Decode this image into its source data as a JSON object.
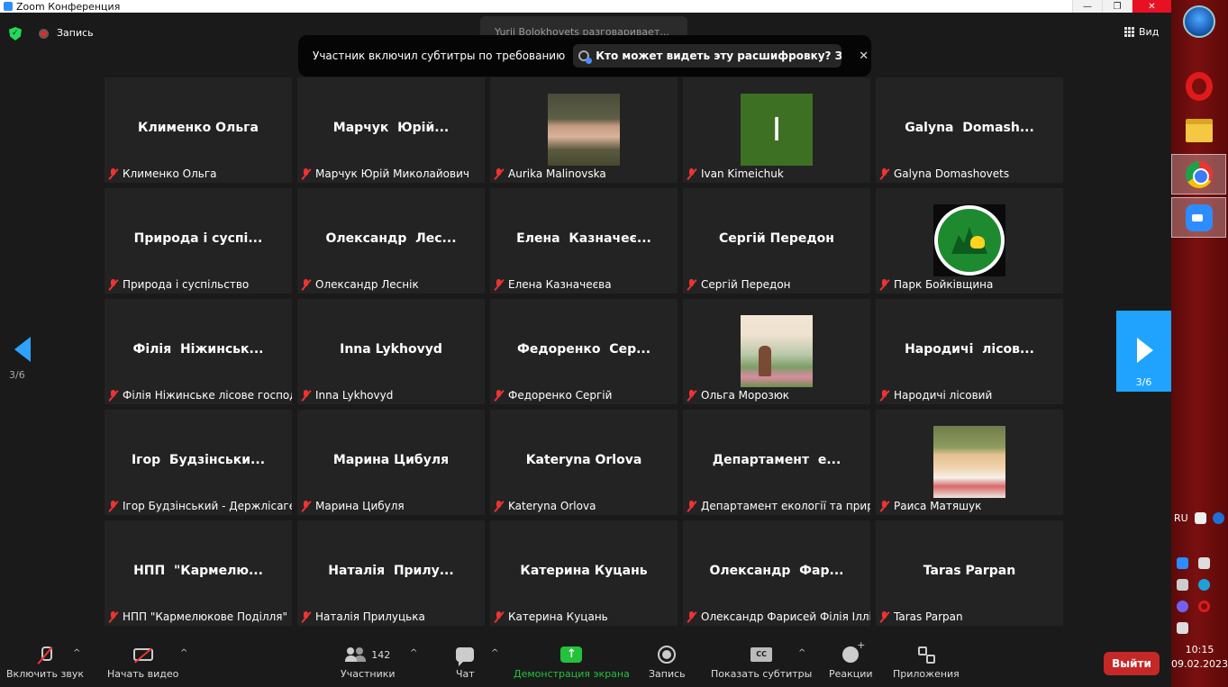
{
  "window": {
    "title": "Zoom Конференция",
    "minimize": "—",
    "maximize": "❐",
    "close": "✕"
  },
  "topbar": {
    "record_label": "Запись",
    "view_label": "Вид",
    "speaking_text": "Yurii Bolokhovets разговаривает...",
    "notification_text": "Участник включил субтитры по требованию",
    "notification_link": "Кто может видеть эту расшифровку? За...",
    "notification_close": "✕"
  },
  "grid": [
    {
      "big": "Клименко Ольга",
      "name": "Клименко Ольга",
      "photo": ""
    },
    {
      "big": "Марчук  Юрій...",
      "name": "Марчук Юрій Миколайович",
      "photo": ""
    },
    {
      "big": "",
      "name": "Aurika Malinovska",
      "photo": "aurika"
    },
    {
      "big": "",
      "name": "Ivan Kimeichuk",
      "photo": "ivan",
      "letter": "I"
    },
    {
      "big": "Galyna  Domash...",
      "name": "Galyna Domashovets",
      "photo": ""
    },
    {
      "big": "Природа і суспі...",
      "name": "Природа і суспільство",
      "photo": ""
    },
    {
      "big": "Олександр  Лес...",
      "name": "Олександр Леснік",
      "photo": ""
    },
    {
      "big": "Елена  Казначеє...",
      "name": "Елена Казначеєва",
      "photo": ""
    },
    {
      "big": "Сергій Передон",
      "name": "Сергій Передон",
      "photo": ""
    },
    {
      "big": "",
      "name": "Парк Бойківщина",
      "photo": "park"
    },
    {
      "big": "Філія  Ніжинськ...",
      "name": "Філія Ніжинське лісове господарство",
      "photo": ""
    },
    {
      "big": "Inna Lykhovyd",
      "name": "Inna Lykhovyd",
      "photo": ""
    },
    {
      "big": "Федоренко  Сер...",
      "name": "Федоренко Сергій",
      "photo": ""
    },
    {
      "big": "",
      "name": "Ольга Морозюк",
      "photo": "olga"
    },
    {
      "big": "Народичі  лісов...",
      "name": "Народичі лісовий",
      "photo": ""
    },
    {
      "big": "Ігор  Будзінськи...",
      "name": "Ігор Будзінський - Держлісагентство",
      "photo": ""
    },
    {
      "big": "Марина Цибуля",
      "name": "Марина Цибуля",
      "photo": ""
    },
    {
      "big": "Kateryna Orlova",
      "name": "Kateryna Orlova",
      "photo": ""
    },
    {
      "big": "Департамент  е...",
      "name": "Департамент екології та природних ресурсів",
      "photo": ""
    },
    {
      "big": "",
      "name": "Раиса Матяшук",
      "photo": "raisa"
    },
    {
      "big": "НПП  \"Кармелю...",
      "name": "НПП \"Кармелюкове Поділля\"",
      "photo": ""
    },
    {
      "big": "Наталія  Прилу...",
      "name": "Наталія Прилуцька",
      "photo": ""
    },
    {
      "big": "Катерина Куцань",
      "name": "Катерина Куцань",
      "photo": ""
    },
    {
      "big": "Олександр  Фар...",
      "name": "Олександр Фарисей Філія Іллінецьке",
      "photo": ""
    },
    {
      "big": "Taras Parpan",
      "name": "Taras Parpan",
      "photo": ""
    }
  ],
  "nav": {
    "page_left": "3/6",
    "page_right": "3/6"
  },
  "toolbar": {
    "unmute_label": "Включить звук",
    "video_label": "Начать видео",
    "participants_count": "142",
    "participants_label": "Участники",
    "chat_label": "Чат",
    "share_label": "Демонстрация экрана",
    "record_label": "Запись",
    "cc_icon_text": "CC",
    "captions_label": "Показать субтитры",
    "reactions_label": "Реакции",
    "apps_label": "Приложения",
    "leave_label": "Выйти",
    "caret": "^",
    "share_color": "#23c23c"
  },
  "taskbar": {
    "lang": "RU",
    "time": "10:15",
    "date": "09.02.2023"
  }
}
